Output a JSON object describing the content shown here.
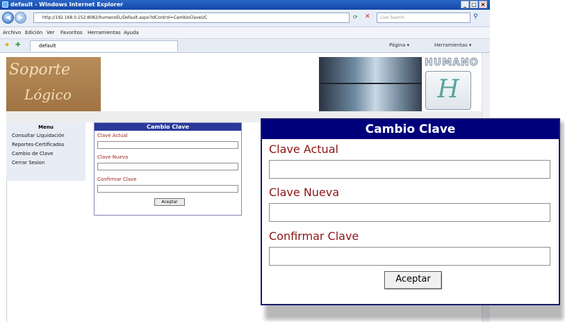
{
  "window": {
    "title": "default - Windows Internet Explorer",
    "address": "http://192.168.0.152:8082/humanoEL/Default.aspx?IdControl=CambioClaveUC",
    "search_placeholder": "Live Search",
    "tab_label": "default",
    "menu": [
      "Archivo",
      "Edición",
      "Ver",
      "Favoritos",
      "Herramientas",
      "Ayuda"
    ],
    "toolbar_right": [
      "Página ▾",
      "Herramientas ▾"
    ]
  },
  "header": {
    "logo_line1": "Soporte",
    "logo_line2": "Lógico",
    "brand": "HUMANO",
    "brand_mark": "H"
  },
  "sidebar": {
    "title": "Menu",
    "items": [
      {
        "label": "Consultar Liquidación"
      },
      {
        "label": "Reportes-Certificados"
      },
      {
        "label": "Cambio de Clave"
      },
      {
        "label": "Cerrar Sesion"
      }
    ]
  },
  "form": {
    "title": "Cambio Clave",
    "fields": [
      {
        "label": "Clave Actual",
        "value": ""
      },
      {
        "label": "Clave Nueva",
        "value": ""
      },
      {
        "label": "Confirmar Clave",
        "value": ""
      }
    ],
    "submit_label": "Aceptar"
  },
  "colors": {
    "form_header": "#00007a",
    "label_text": "#8b1515",
    "logo_bg": "#a07442"
  }
}
